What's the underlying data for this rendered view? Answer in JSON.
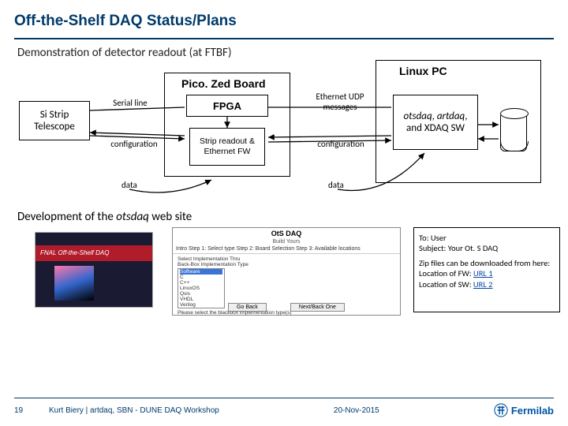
{
  "title": "Off-the-Shelf DAQ Status/Plans",
  "subhead": "Demonstration of detector readout (at FTBF)",
  "diagram": {
    "si": "Si Strip\nTelescope",
    "picozed": "Pico. Zed Board",
    "fpga": "FPGA",
    "strip_fw": "Strip readout & Ethernet FW",
    "linuxpc": "Linux PC",
    "sw_line1": "otsdaq",
    "sw_line2": "artdaq",
    "sw_line3": "XDAQ SW",
    "serial": "Serial line",
    "config": "configuration",
    "data": "data",
    "eth": "Ethernet UDP messages"
  },
  "section2": {
    "lead": "Development of the ",
    "em": "otsdaq",
    "tail": " web site"
  },
  "screenshot1": {
    "banner": "FNAL Off-the-Shelf DAQ"
  },
  "screenshot2": {
    "title": "OtS DAQ",
    "subtitle": "Build Yours",
    "tabs": "Intro    Step 1: Select type    Step 2: Board Selection    Step 3: Available locations",
    "body_label": "Select Implementation Thru",
    "body_sub": "Back-Box Implementation Type",
    "opt_hl": "Software",
    "opt2": "C",
    "opt3": "C++",
    "opt4": "LinuxOS",
    "opt5": "Qsis",
    "opt6": "VHDL",
    "opt7": "Verilog",
    "note": "Please select the blackbox implementation type(s)",
    "btn_back": "Go Back",
    "btn_next": "Next/Back One"
  },
  "msg": {
    "to": "To: User",
    "subj": "Subject: Your Ot. S DAQ",
    "body": "Zip files can be downloaded from here:",
    "fw": "Location of FW: ",
    "fw_link": "URL 1",
    "sw": "Location of SW: ",
    "sw_link": "URL 2"
  },
  "footer": {
    "page": "19",
    "credit": "Kurt Biery | artdaq, SBN - DUNE DAQ Workshop",
    "date": "20-Nov-2015",
    "lab": "Fermilab"
  }
}
